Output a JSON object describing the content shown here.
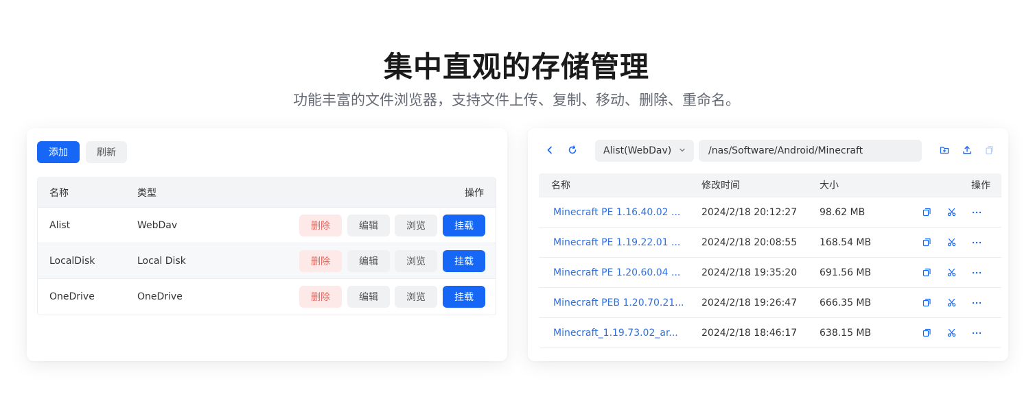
{
  "hero": {
    "title": "集中直观的存储管理",
    "subtitle": "功能丰富的文件浏览器，支持文件上传、复制、移动、删除、重命名。"
  },
  "storage_panel": {
    "toolbar": {
      "add_label": "添加",
      "refresh_label": "刷新"
    },
    "columns": {
      "name": "名称",
      "type": "类型",
      "actions": "操作"
    },
    "action_labels": {
      "delete": "删除",
      "edit": "编辑",
      "browse": "浏览",
      "mount": "挂载"
    },
    "rows": [
      {
        "name": "Alist",
        "type": "WebDav"
      },
      {
        "name": "LocalDisk",
        "type": "Local Disk"
      },
      {
        "name": "OneDrive",
        "type": "OneDrive"
      }
    ]
  },
  "file_browser": {
    "storage_select": "Alist(WebDav)",
    "path": "/nas/Software/Android/Minecraft",
    "icons": {
      "back": "chevron-left-icon",
      "refresh": "refresh-icon",
      "new_folder": "new-folder-icon",
      "upload": "upload-icon",
      "paste": "paste-icon",
      "copy": "copy-icon",
      "cut": "scissors-icon",
      "more": "more-icon"
    },
    "columns": {
      "name": "名称",
      "modified": "修改时间",
      "size": "大小",
      "actions": "操作"
    },
    "files": [
      {
        "name": "Minecraft PE 1.16.40.02 ...",
        "modified": "2024/2/18 20:12:27",
        "size": "98.62 MB"
      },
      {
        "name": "Minecraft PE 1.19.22.01 ...",
        "modified": "2024/2/18 20:08:55",
        "size": "168.54 MB"
      },
      {
        "name": "Minecraft PE 1.20.60.04 ...",
        "modified": "2024/2/18 19:35:20",
        "size": "691.56 MB"
      },
      {
        "name": "Minecraft PEB 1.20.70.21...",
        "modified": "2024/2/18 19:26:47",
        "size": "666.35 MB"
      },
      {
        "name": "Minecraft_1.19.73.02_ar...",
        "modified": "2024/2/18 18:46:17",
        "size": "638.15 MB"
      }
    ]
  },
  "colors": {
    "primary": "#1667f5",
    "danger_bg": "#fde9e8",
    "danger_text": "#e8675e",
    "link": "#2f6fe0"
  }
}
